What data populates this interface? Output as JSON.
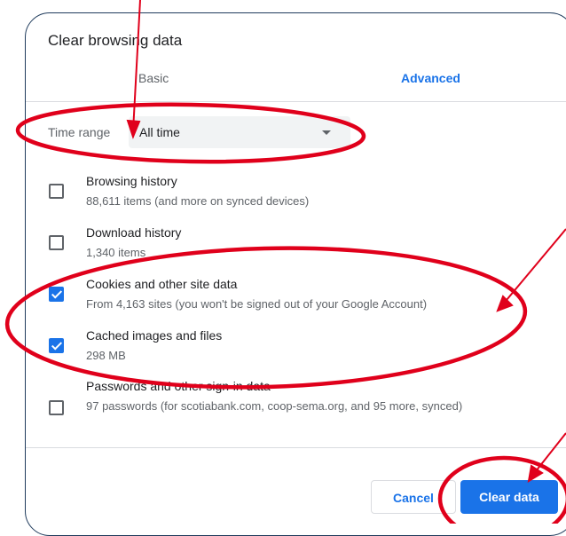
{
  "dialog": {
    "title": "Clear browsing data"
  },
  "tabs": [
    {
      "label": "Basic",
      "active": false
    },
    {
      "label": "Advanced",
      "active": true
    }
  ],
  "time_range": {
    "label": "Time range",
    "value": "All time"
  },
  "items": [
    {
      "label": "Browsing history",
      "sub": "88,611 items (and more on synced devices)",
      "checked": false
    },
    {
      "label": "Download history",
      "sub": "1,340 items",
      "checked": false
    },
    {
      "label": "Cookies and other site data",
      "sub": "From 4,163 sites (you won't be signed out of your Google Account)",
      "checked": true
    },
    {
      "label": "Cached images and files",
      "sub": "298 MB",
      "checked": true
    },
    {
      "label": "Passwords and other sign-in data",
      "sub": "97 passwords (for scotiabank.com, coop-sema.org, and 95 more, synced)",
      "checked": false
    }
  ],
  "buttons": {
    "cancel": "Cancel",
    "clear": "Clear data"
  },
  "colors": {
    "accent": "#1a73e8",
    "annotation": "#e0001b"
  }
}
